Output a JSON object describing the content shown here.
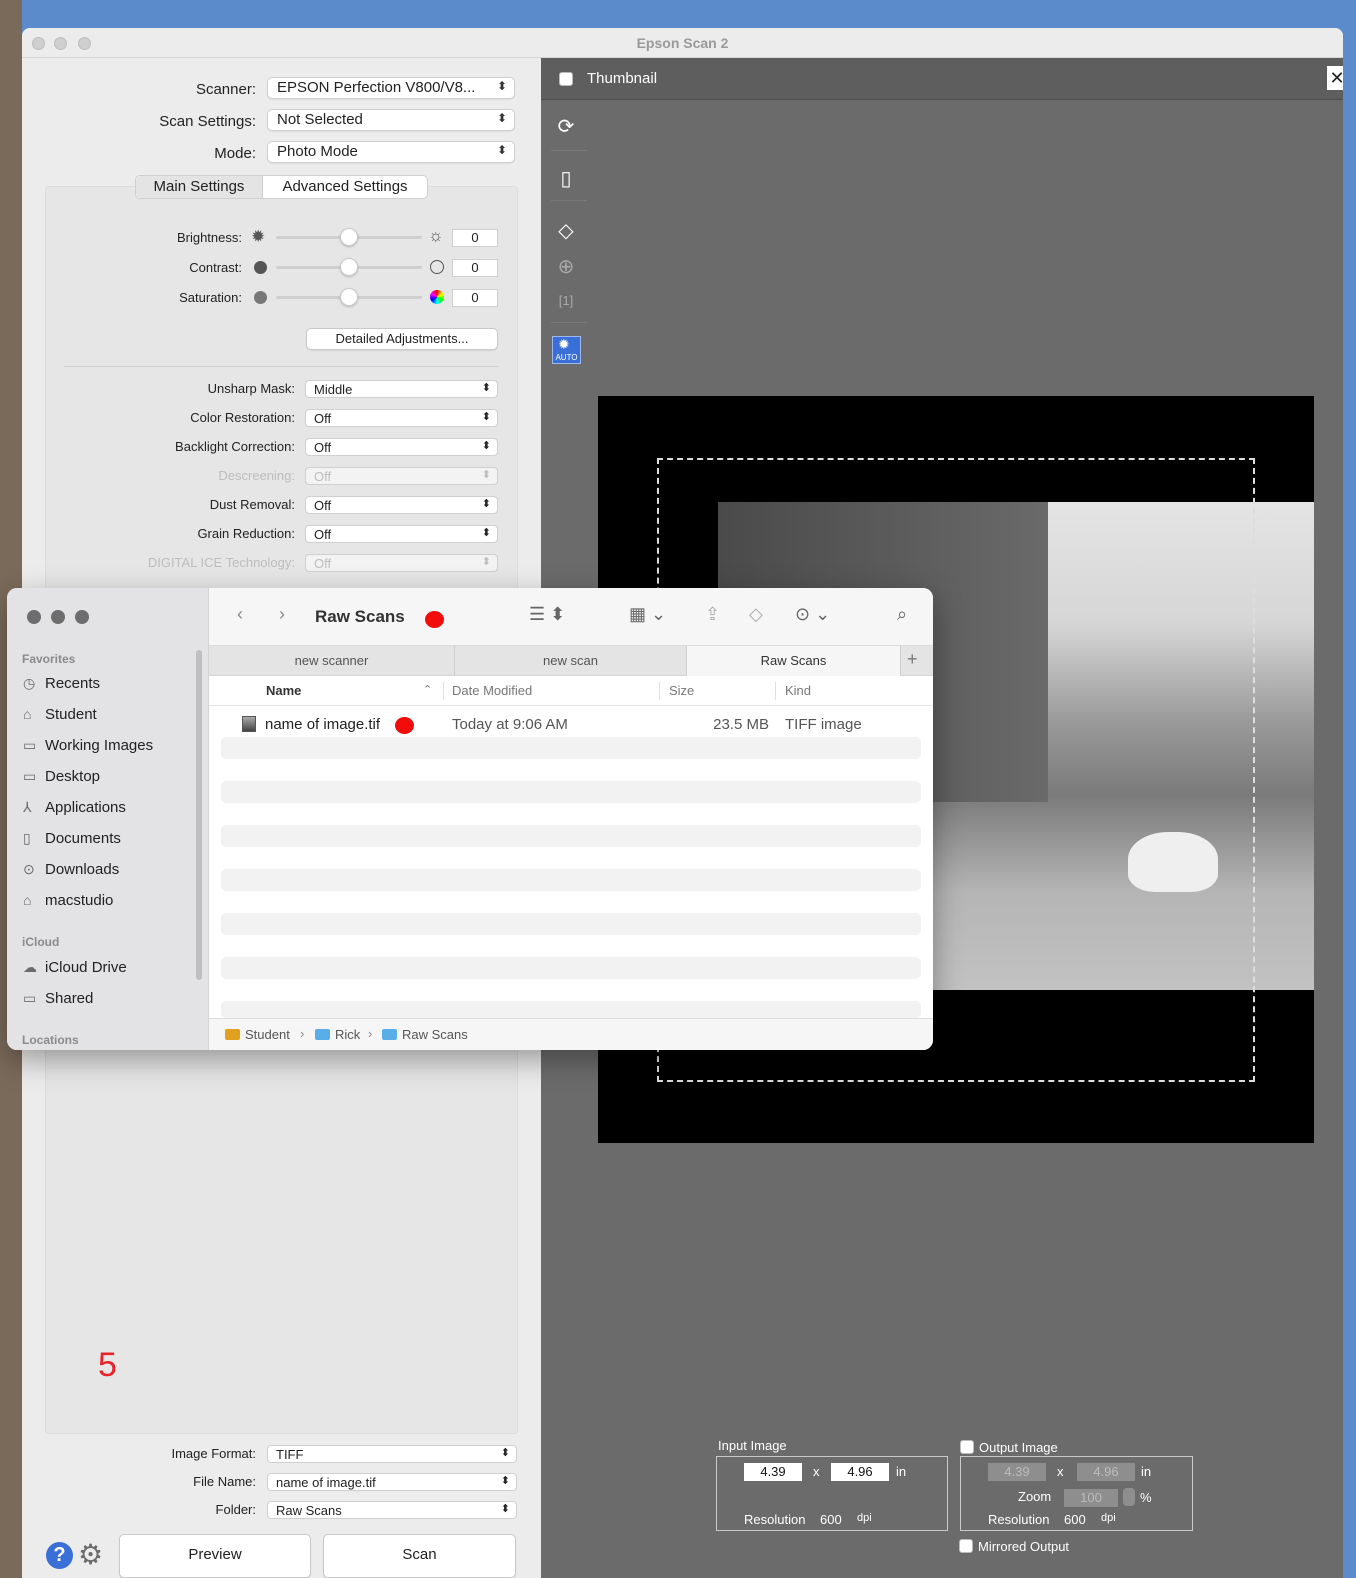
{
  "epson": {
    "window_title": "Epson Scan 2",
    "scanner": {
      "label": "Scanner:",
      "value": "EPSON Perfection V800/V8..."
    },
    "scan_settings": {
      "label": "Scan Settings:",
      "value": "Not Selected"
    },
    "mode": {
      "label": "Mode:",
      "value": "Photo Mode"
    },
    "tabs": [
      "Main Settings",
      "Advanced Settings"
    ],
    "sliders": [
      {
        "label": "Brightness:",
        "value": "0",
        "level": 0.5
      },
      {
        "label": "Contrast:",
        "value": "0",
        "level": 0.5
      },
      {
        "label": "Saturation:",
        "value": "0",
        "level": 0.5
      }
    ],
    "detailed_button": "Detailed Adjustments...",
    "options": [
      {
        "label": "Unsharp Mask:",
        "value": "Middle",
        "enabled": true
      },
      {
        "label": "Color Restoration:",
        "value": "Off",
        "enabled": true
      },
      {
        "label": "Backlight Correction:",
        "value": "Off",
        "enabled": true
      },
      {
        "label": "Descreening:",
        "value": "Off",
        "enabled": false
      },
      {
        "label": "Dust Removal:",
        "value": "Off",
        "enabled": true
      },
      {
        "label": "Grain Reduction:",
        "value": "Off",
        "enabled": true
      },
      {
        "label": "DIGITAL ICE Technology:",
        "value": "Off",
        "enabled": false
      }
    ],
    "annotation_number": "5",
    "image_format": {
      "label": "Image Format:",
      "value": "TIFF"
    },
    "file_name": {
      "label": "File Name:",
      "value": "name of image.tif"
    },
    "folder": {
      "label": "Folder:",
      "value": "Raw Scans"
    },
    "preview_button": "Preview",
    "scan_button": "Scan",
    "thumbnail_label": "Thumbnail",
    "auto_label": "AUTO",
    "input_image": {
      "title": "Input Image",
      "width": "4.39",
      "height": "4.96",
      "x": "x",
      "unit": "in",
      "resolution_label": "Resolution",
      "resolution": "600",
      "dpi": "dpi"
    },
    "output_image": {
      "title": "Output Image",
      "width": "4.39",
      "height": "4.96",
      "x": "x",
      "unit": "in",
      "zoom_label": "Zoom",
      "zoom": "100",
      "percent": "%",
      "resolution_label": "Resolution",
      "resolution": "600",
      "dpi": "dpi"
    },
    "mirrored_label": "Mirrored Output",
    "accent": "#3a6fd8"
  },
  "finder": {
    "title": "Raw Scans",
    "sidebar": {
      "favorites_head": "Favorites",
      "favorites": [
        {
          "label": "Recents",
          "icon": "clock-icon"
        },
        {
          "label": "Student",
          "icon": "drive-icon"
        },
        {
          "label": "Working Images",
          "icon": "folder-icon"
        },
        {
          "label": "Desktop",
          "icon": "desktop-icon"
        },
        {
          "label": "Applications",
          "icon": "applications-icon"
        },
        {
          "label": "Documents",
          "icon": "document-icon"
        },
        {
          "label": "Downloads",
          "icon": "download-icon"
        },
        {
          "label": "macstudio",
          "icon": "home-icon"
        }
      ],
      "icloud_head": "iCloud",
      "icloud": [
        {
          "label": "iCloud Drive",
          "icon": "cloud-icon"
        },
        {
          "label": "Shared",
          "icon": "shared-folder-icon"
        }
      ],
      "locations_head": "Locations"
    },
    "tabs": [
      "new scanner",
      "new scan",
      "Raw Scans"
    ],
    "columns": {
      "name": "Name",
      "date": "Date Modified",
      "size": "Size",
      "kind": "Kind"
    },
    "files": [
      {
        "name": "name of image.tif",
        "date": "Today at 9:06 AM",
        "size": "23.5 MB",
        "kind": "TIFF image"
      }
    ],
    "path": [
      "Student",
      "Rick",
      "Raw Scans"
    ],
    "path_sep": "›"
  }
}
